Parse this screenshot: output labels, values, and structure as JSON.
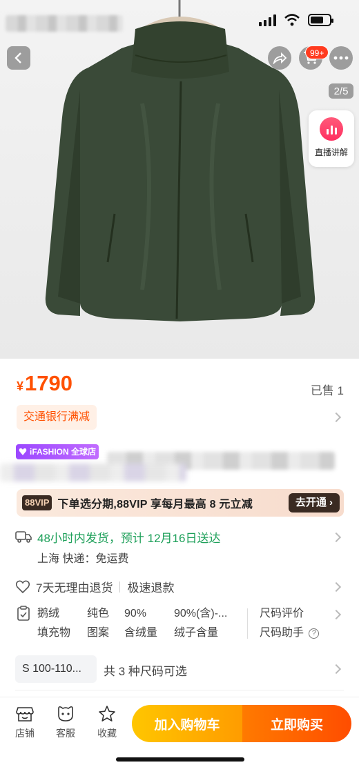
{
  "status_bar": {
    "signal_icon": "cellular-signal-icon",
    "wifi_icon": "wifi-icon",
    "battery_icon": "battery-icon"
  },
  "hero": {
    "back_icon": "chevron-left-icon",
    "share_icon": "share-arrow-icon",
    "cart_icon": "cart-icon",
    "cart_badge": "99+",
    "more_icon": "more-dots-icon",
    "page_indicator": "2/5",
    "live": {
      "icon": "live-bars-icon",
      "label": "直播讲解"
    }
  },
  "price": {
    "currency": "¥",
    "value": "1790",
    "sold": "已售 1"
  },
  "promo": {
    "label": "交通银行满减"
  },
  "store": {
    "tag": "iFASHION 全球店"
  },
  "vip": {
    "badge": "88VIP",
    "text": "下单选分期,88VIP 享每月最高 8 元立减",
    "button": "去开通"
  },
  "shipping": {
    "line1": "48小时内发货，预计 12月16日送达",
    "line2": "上海  快递：免运费"
  },
  "returns": {
    "left": "7天无理由退货",
    "right": "极速退款"
  },
  "params": [
    {
      "value": "鹅绒",
      "name": "填充物"
    },
    {
      "value": "纯色",
      "name": "图案"
    },
    {
      "value": "90%",
      "name": "含绒量"
    },
    {
      "value": "90%(含)-...",
      "name": "绒子含量"
    }
  ],
  "size_help": {
    "line1": "尺码评价",
    "line2": "尺码助手"
  },
  "size": {
    "chip": "S 100-110...",
    "text": "共 3 种尺码可选"
  },
  "bottom": {
    "store": "店铺",
    "service": "客服",
    "favorite": "收藏",
    "add_to_cart": "加入购物车",
    "buy_now": "立即购买"
  },
  "colors": {
    "accent": "#ff5000",
    "green": "#1ea05a"
  }
}
